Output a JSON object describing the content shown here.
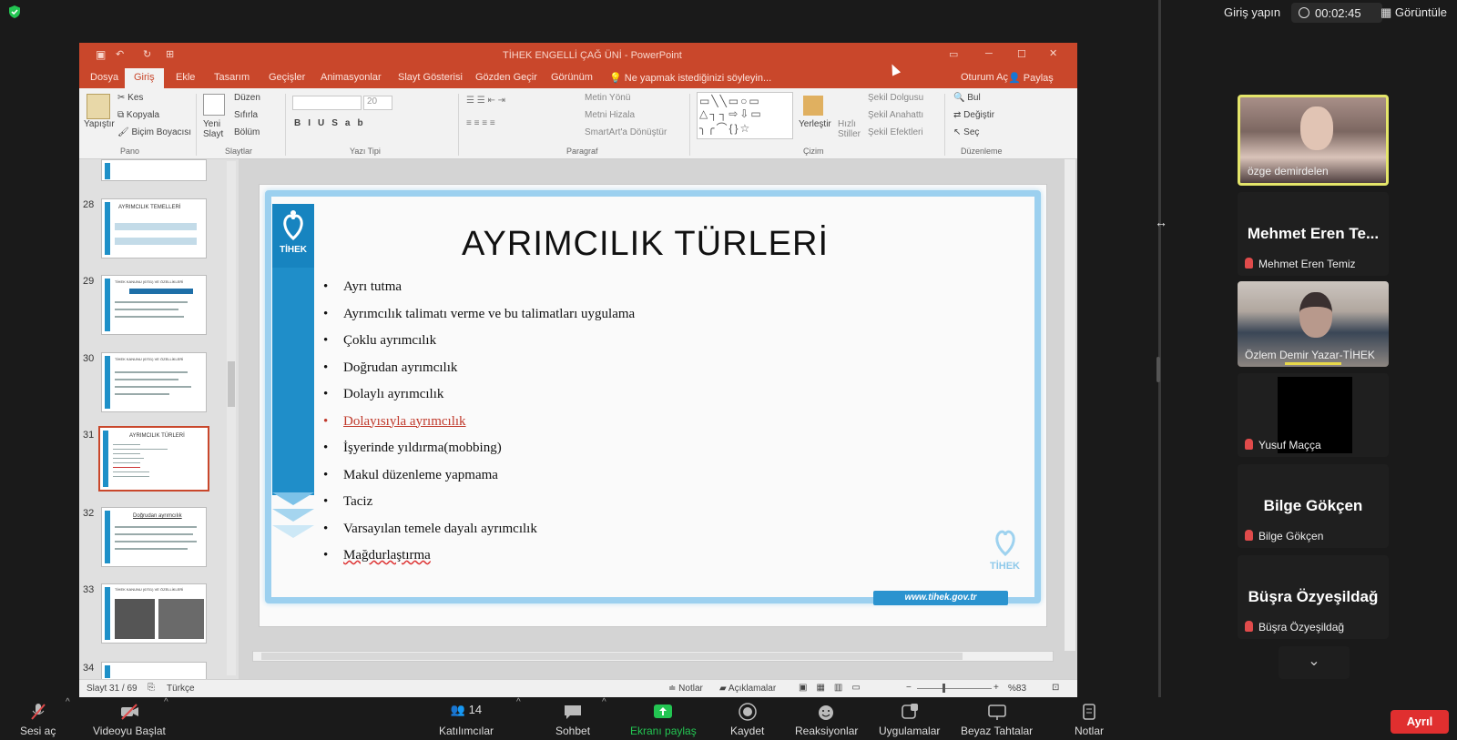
{
  "zoom_top": {
    "signin": "Giriş yapın",
    "timer": "00:02:45",
    "view": "Görüntüle"
  },
  "ppt": {
    "title": "TİHEK ENGELLİ ÇAĞ ÜNİ - PowerPoint",
    "tabs": [
      "Dosya",
      "Giriş",
      "Ekle",
      "Tasarım",
      "Geçişler",
      "Animasyonlar",
      "Slayt Gösterisi",
      "Gözden Geçir",
      "Görünüm"
    ],
    "tellme": "Ne yapmak istediğinizi söyleyin...",
    "signin": "Oturum Aç",
    "share": "Paylaş",
    "ribbon": {
      "paste": "Yapıştır",
      "cut": "Kes",
      "copy": "Kopyala",
      "format_painter": "Biçim Boyacısı",
      "pano": "Pano",
      "new_slide": "Yeni Slayt",
      "layout": "Düzen",
      "reset": "Sıfırla",
      "section": "Bölüm",
      "slides": "Slaytlar",
      "font_size": "20",
      "font_group": "Yazı Tipi",
      "text_dir": "Metin Yönü",
      "align_text": "Metni Hizala",
      "smartart": "SmartArt'a Dönüştür",
      "paragraph": "Paragraf",
      "arrange": "Yerleştir",
      "quick_styles": "Hızlı Stiller",
      "shape_fill": "Şekil Dolgusu",
      "shape_outline": "Şekil Anahattı",
      "shape_effects": "Şekil Efektleri",
      "drawing": "Çizim",
      "find": "Bul",
      "replace": "Değiştir",
      "select": "Seç",
      "editing": "Düzenleme"
    },
    "thumbs": [
      {
        "num": "28",
        "title": "AYRIMCILIK TEMELLERİ"
      },
      {
        "num": "29",
        "title": "TİHEK KANUNU (6701) VE ÖZELLİKLERİ"
      },
      {
        "num": "30",
        "title": "TİHEK KANUNU (6701) VE ÖZELLİKLERİ"
      },
      {
        "num": "31",
        "title": "AYRIMCILIK TÜRLERİ"
      },
      {
        "num": "32",
        "title": "Doğrudan ayrımcılık"
      },
      {
        "num": "33",
        "title": "TİHEK KANUNU (6701) VE ÖZELLİKLERİ"
      },
      {
        "num": "34",
        "title": ""
      }
    ],
    "slide": {
      "logo_text": "TİHEK",
      "title": "AYRIMCILIK TÜRLERİ",
      "bullets": [
        "Ayrı tutma",
        "Ayrımcılık talimatı verme ve bu talimatları uygulama",
        "Çoklu ayrımcılık",
        "Doğrudan ayrımcılık",
        "Dolaylı ayrımcılık",
        "Dolayısıyla ayrımcılık",
        "İşyerinde yıldırma(mobbing)",
        "Makul düzenleme yapmama",
        "Taciz",
        "Varsayılan temele dayalı ayrımcılık",
        "Mağdurlaştırma"
      ],
      "watermark": "TİHEK",
      "url": "www.tihek.gov.tr"
    },
    "status": {
      "slide_count": "Slayt 31 / 69",
      "language": "Türkçe",
      "notes": "Notlar",
      "comments": "Açıklamalar",
      "zoom": "%83"
    }
  },
  "participants": {
    "p1": "özge demirdelen",
    "p2_big": "Mehmet Eren Te...",
    "p2": "Mehmet Eren Temiz",
    "p3": "Özlem Demir Yazar-TİHEK",
    "p4": "Yusuf Maçça",
    "p5_big": "Bilge Gökçen",
    "p5": "Bilge Gökçen",
    "p6_big": "Büşra Özyeşildağ",
    "p6": "Büşra Özyeşildağ"
  },
  "bottom": {
    "mute": "Sesi aç",
    "video": "Videoyu Başlat",
    "participants": "Katılımcılar",
    "participants_count": "14",
    "chat": "Sohbet",
    "share": "Ekranı paylaş",
    "record": "Kaydet",
    "reactions": "Reaksiyonlar",
    "apps": "Uygulamalar",
    "whiteboards": "Beyaz Tahtalar",
    "notes": "Notlar",
    "leave": "Ayrıl"
  },
  "colors": {
    "ppt_accent": "#c9472b",
    "tihek_blue": "#1f8ec9",
    "leave_red": "#e02f2f",
    "share_green": "#23c552"
  }
}
